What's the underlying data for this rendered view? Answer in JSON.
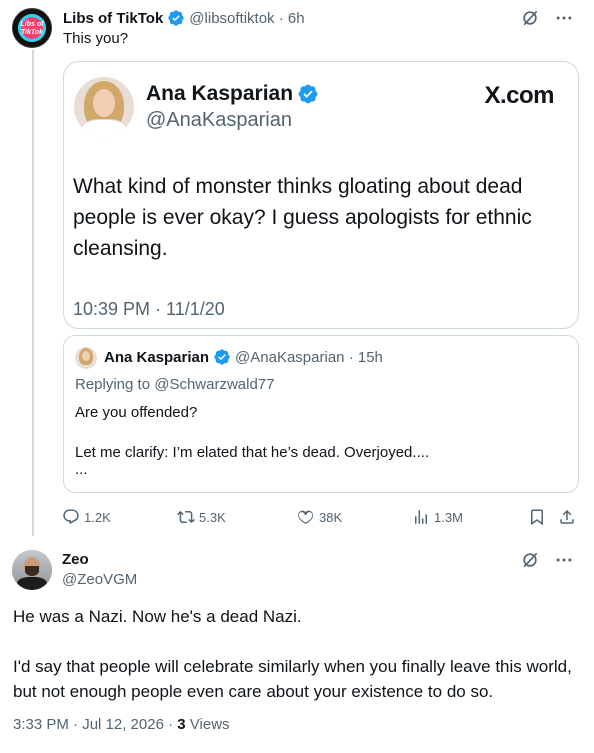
{
  "original_tweet": {
    "name": "Libs of TikTok",
    "handle": "@libsoftiktok",
    "separator": "·",
    "time": "6h",
    "avatar_text_1": "Libs of",
    "avatar_text_2": "TikTok",
    "text": "This you?"
  },
  "screenshot_card": {
    "name": "Ana Kasparian",
    "handle": "@AnaKasparian",
    "source": "X.com",
    "body": "What kind of monster thinks gloating about dead people is ever okay? I guess apologists for ethnic cleansing.",
    "timestamp": "10:39 PM · 11/1/20"
  },
  "quoted_tweet": {
    "name": "Ana Kasparian",
    "handle": "@AnaKasparian",
    "separator": "·",
    "time": "15h",
    "replying_to": "Replying to @Schwarzwald77",
    "line1": "Are you offended?",
    "line2": "Let me clarify: I’m elated that he’s dead. Overjoyed....",
    "line3": "..."
  },
  "actions": {
    "replies": "1.2K",
    "reposts": "5.3K",
    "likes": "38K",
    "views": "1.3M"
  },
  "reply_tweet": {
    "name": "Zeo",
    "handle": "@ZeoVGM",
    "paragraph1": "He was a Nazi. Now he's a dead Nazi.",
    "paragraph2": "I'd say that people will celebrate similarly when you finally leave this world, but not enough people even care about your existence to do so.",
    "timestamp": "3:33 PM · Jul 12, 2026 ·",
    "views_count": "3",
    "views_label": "Views"
  },
  "colors": {
    "verified_blue": "#1d9bf0",
    "secondary_text": "#536471",
    "border": "#cfd9de"
  },
  "icons": [
    "verified-badge-icon",
    "grok-icon",
    "more-icon",
    "reply-icon",
    "repost-icon",
    "like-icon",
    "views-icon",
    "bookmark-icon",
    "share-icon"
  ]
}
